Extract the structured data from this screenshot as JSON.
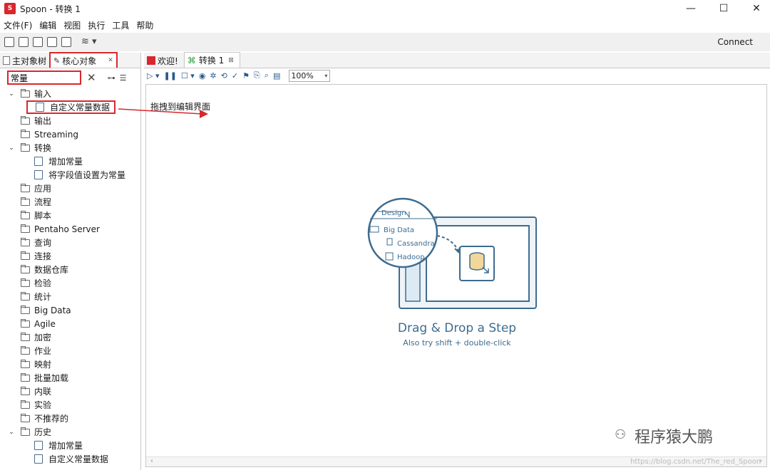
{
  "window": {
    "title": "Spoon - 转换 1",
    "logo_text": "S",
    "controls": {
      "minimize": "—",
      "maximize": "☐",
      "close": "✕"
    }
  },
  "menu": [
    "文件(F)",
    "编辑",
    "视图",
    "执行",
    "工具",
    "帮助"
  ],
  "toolbar": {
    "connect_label": "Connect"
  },
  "left_panel": {
    "tabs": [
      "主对象树",
      "核心对象"
    ],
    "active_tab": "核心对象",
    "search_value": "常量",
    "tree": [
      {
        "type": "folder",
        "label": "输入",
        "expanded": true
      },
      {
        "type": "leaf",
        "label": "自定义常量数据",
        "highlighted": true
      },
      {
        "type": "folder",
        "label": "输出"
      },
      {
        "type": "folder",
        "label": "Streaming"
      },
      {
        "type": "folder",
        "label": "转换",
        "expanded": true
      },
      {
        "type": "leaf",
        "label": "增加常量"
      },
      {
        "type": "leaf",
        "label": "将字段值设置为常量"
      },
      {
        "type": "folder",
        "label": "应用"
      },
      {
        "type": "folder",
        "label": "流程"
      },
      {
        "type": "folder",
        "label": "脚本"
      },
      {
        "type": "folder",
        "label": "Pentaho Server"
      },
      {
        "type": "folder",
        "label": "查询"
      },
      {
        "type": "folder",
        "label": "连接"
      },
      {
        "type": "folder",
        "label": "数据仓库"
      },
      {
        "type": "folder",
        "label": "检验"
      },
      {
        "type": "folder",
        "label": "统计"
      },
      {
        "type": "folder",
        "label": "Big Data"
      },
      {
        "type": "folder",
        "label": "Agile"
      },
      {
        "type": "folder",
        "label": "加密"
      },
      {
        "type": "folder",
        "label": "作业"
      },
      {
        "type": "folder",
        "label": "映射"
      },
      {
        "type": "folder",
        "label": "批量加载"
      },
      {
        "type": "folder",
        "label": "内联"
      },
      {
        "type": "folder",
        "label": "实验"
      },
      {
        "type": "folder",
        "label": "不推荐的"
      },
      {
        "type": "folder",
        "label": "历史",
        "expanded": true
      },
      {
        "type": "leaf",
        "label": "增加常量"
      },
      {
        "type": "leaf",
        "label": "自定义常量数据"
      }
    ]
  },
  "editor": {
    "tabs": [
      {
        "label": "欢迎!",
        "active": false
      },
      {
        "label": "转换 1",
        "active": true
      }
    ],
    "zoom": "100%",
    "annotation": "拖拽到编辑界面",
    "design_illustration": {
      "tab": "Design",
      "items": [
        "Big Data",
        "Cassandra",
        "Hadoop"
      ]
    },
    "drag_drop_title": "Drag & Drop a Step",
    "drag_drop_subtitle": "Also try shift + double-click"
  },
  "watermark": "程序猿大鹏",
  "url_watermark": "https://blog.csdn.net/The_red_Spoon",
  "colors": {
    "highlight_red": "#d9272e",
    "illustration_blue": "#3d6c8f",
    "transform_green": "#2d9d3a"
  }
}
